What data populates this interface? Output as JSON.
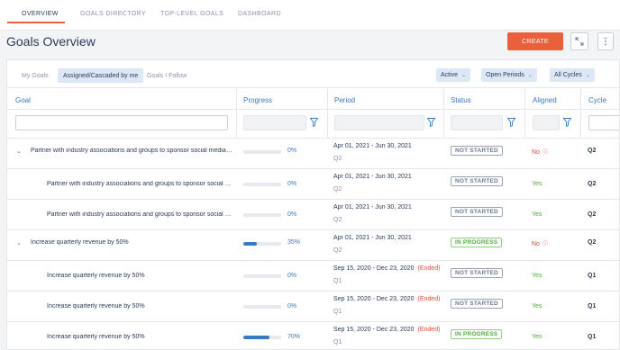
{
  "nav": {
    "tabs": [
      "OVERVIEW",
      "GOALS DIRECTORY",
      "TOP-LEVEL GOALS",
      "DASHBOARD"
    ]
  },
  "page": {
    "title": "Goals Overview",
    "create_label": "CREATE"
  },
  "subtabs": [
    "My Goals",
    "Assigned/Cascaded by me",
    "Goals I Follow"
  ],
  "filters": [
    "Active",
    "Open Periods",
    "All Cycles"
  ],
  "columns": [
    "Goal",
    "Progress",
    "Period",
    "Status",
    "Aligned",
    "Cycle"
  ],
  "rows": [
    {
      "goal": "Partner with industry associations and groups to sponsor social media e...",
      "progress_label": "0%",
      "progress": 0,
      "period": "Apr 01, 2021 - Jun 30, 2021",
      "ended": "",
      "quarter": "Q2",
      "status": "NOT STARTED",
      "aligned": "No",
      "cycle": "Q2"
    },
    {
      "goal": "Partner with industry associations and groups to sponsor social m...",
      "progress_label": "0%",
      "progress": 0,
      "period": "Apr 01, 2021 - Jun 30, 2021",
      "ended": "",
      "quarter": "Q2",
      "status": "NOT STARTED",
      "aligned": "Yes",
      "cycle": "Q2"
    },
    {
      "goal": "Partner with industry associations and groups to sponsor social m...",
      "progress_label": "0%",
      "progress": 0,
      "period": "Apr 01, 2021 - Jun 30, 2021",
      "ended": "",
      "quarter": "Q2",
      "status": "NOT STARTED",
      "aligned": "Yes",
      "cycle": "Q2"
    },
    {
      "goal": "Increase quarterly revenue by 50%",
      "progress_label": "35%",
      "progress": 35,
      "period": "Apr 01, 2021 - Jun 30, 2021",
      "ended": "",
      "quarter": "Q2",
      "status": "IN PROGRESS",
      "aligned": "No",
      "cycle": "Q2"
    },
    {
      "goal": "Increase quarterly revenue by 50%",
      "progress_label": "0%",
      "progress": 0,
      "period": "Sep 15, 2020 - Dec 23, 2020",
      "ended": "(Ended)",
      "quarter": "Q1",
      "status": "NOT STARTED",
      "aligned": "Yes",
      "cycle": "Q1"
    },
    {
      "goal": "Increase quarterly revenue by 50%",
      "progress_label": "0%",
      "progress": 0,
      "period": "Sep 15, 2020 - Dec 23, 2020",
      "ended": "(Ended)",
      "quarter": "Q1",
      "status": "NOT STARTED",
      "aligned": "Yes",
      "cycle": "Q1"
    },
    {
      "goal": "Increase quarterly revenue by 50%",
      "progress_label": "70%",
      "progress": 70,
      "period": "Sep 15, 2020 - Dec 23, 2020",
      "ended": "(Ended)",
      "quarter": "Q1",
      "status": "IN PROGRESS",
      "aligned": "Yes",
      "cycle": "Q1"
    }
  ],
  "colors": {
    "accent": "#e8613c",
    "link": "#3a78c4",
    "success": "#4caf3a",
    "danger": "#e0483e"
  }
}
